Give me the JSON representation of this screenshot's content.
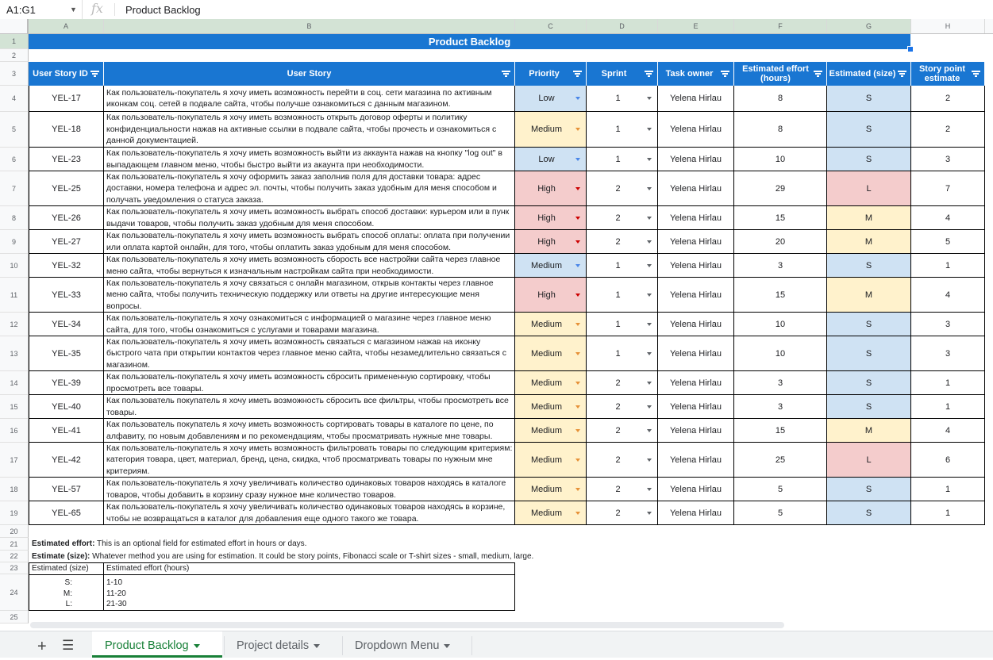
{
  "formula_bar": {
    "name_box": "A1:G1",
    "fx": "fx",
    "content": "Product Backlog"
  },
  "columns": [
    "A",
    "B",
    "C",
    "D",
    "E",
    "F",
    "G",
    "H"
  ],
  "rows": [
    "1",
    "2",
    "3",
    "4",
    "5",
    "6",
    "7",
    "8",
    "9",
    "10",
    "11",
    "12",
    "13",
    "14",
    "15",
    "16",
    "17",
    "18",
    "19",
    "20",
    "21",
    "22",
    "23",
    "24",
    "25"
  ],
  "title": "Product Backlog",
  "headers": {
    "id": "User Story ID",
    "story": "User Story",
    "priority": "Priority",
    "sprint": "Sprint",
    "owner": "Task owner",
    "effort": "Estimated effort (hours)",
    "size": "Estimated (size)",
    "points": "Story point estimate"
  },
  "stories": [
    {
      "id": "YEL-17",
      "story": "Как пользователь-покупатель я хочу иметь возможность перейти в соц. сети магазина по активным иконкам соц. сетей в подвале сайта, чтобы получше ознакомиться с данным магазином.",
      "priority": "Low",
      "sprint": "1",
      "owner": "Yelena Hirlau",
      "effort": "8",
      "size": "S",
      "points": "2"
    },
    {
      "id": "YEL-18",
      "story": "Как пользователь-покупатель я хочу иметь возможность открыть договор оферты и политику конфиденциальности нажав на активные ссылки в подвале сайта, чтобы прочесть и ознакомиться с данной документацией.",
      "priority": "Medium",
      "sprint": "1",
      "owner": "Yelena Hirlau",
      "effort": "8",
      "size": "S",
      "points": "2"
    },
    {
      "id": "YEL-23",
      "story": "Как пользователь-покупатель я хочу иметь возможность выйти из аккаунта нажав на кнопку \"log out\" в выпадающем главном меню, чтобы быстро выйти из акаунта при необходимости.",
      "priority": "Low",
      "sprint": "1",
      "owner": "Yelena Hirlau",
      "effort": "10",
      "size": "S",
      "points": "3"
    },
    {
      "id": "YEL-25",
      "story": "Как пользователь-покупатель я хочу оформить заказ заполнив поля для доставки товара: адрес доставки, номера телефона и адрес эл. почты, чтобы получить заказ удобным для меня способом и получать уведомления о статуса заказа.",
      "priority": "High",
      "sprint": "2",
      "owner": "Yelena Hirlau",
      "effort": "29",
      "size": "L",
      "points": "7"
    },
    {
      "id": "YEL-26",
      "story": "Как пользователь-покупатель я хочу иметь возможность выбрать способ доставки: курьером или в пунк выдачи товаров, чтобы получить заказ удобным для меня способом.",
      "priority": "High",
      "sprint": "2",
      "owner": "Yelena Hirlau",
      "effort": "15",
      "size": "M",
      "points": "4"
    },
    {
      "id": "YEL-27",
      "story": "Как пользователь-покупатель я хочу иметь возможность выбрать способ оплаты: оплата при получении или оплата картой онлайн, для того, чтобы оплатить заказ удобным для меня способом.",
      "priority": "High",
      "sprint": "2",
      "owner": "Yelena Hirlau",
      "effort": "20",
      "size": "M",
      "points": "5"
    },
    {
      "id": "YEL-32",
      "story": "Как пользователь-покупатель я хочу иметь возможность сборость все настройки сайта через главное меню сайта, чтобы вернуться к изначальным настройкам сайта при необходимости.",
      "priority": "Medium",
      "sprint": "1",
      "owner": "Yelena Hirlau",
      "effort": "3",
      "size": "S",
      "points": "1",
      "priorityStyle": "low"
    },
    {
      "id": "YEL-33",
      "story": "Как пользователь-покупатель я хочу связаться с онлайн магазином, открыв контакты через главное меню сайта, чтобы получить техническую поддержку или ответы на другие интересующие меня вопросы.",
      "priority": "High",
      "sprint": "1",
      "owner": "Yelena Hirlau",
      "effort": "15",
      "size": "M",
      "points": "4"
    },
    {
      "id": "YEL-34",
      "story": "Как пользователь-покупатель я хочу ознакомиться с информацией о магазине через главное меню сайта, для того, чтобы ознакомиться с услугами и товарами магазина.",
      "priority": "Medium",
      "sprint": "1",
      "owner": "Yelena Hirlau",
      "effort": "10",
      "size": "S",
      "points": "3"
    },
    {
      "id": "YEL-35",
      "story": "Как пользователь-покупатель я хочу иметь возможность связаться с магазином нажав на иконку быстрого чата при открытии контактов через главное меню сайта, чтобы незамедлительно связаться с магазином.",
      "priority": "Medium",
      "sprint": "1",
      "owner": "Yelena Hirlau",
      "effort": "10",
      "size": "S",
      "points": "3"
    },
    {
      "id": "YEL-39",
      "story": "Как пользователь-покупатель я хочу иметь возможность сбросить примененную сортировку, чтобы просмотреть все товары.",
      "priority": "Medium",
      "sprint": "2",
      "owner": "Yelena Hirlau",
      "effort": "3",
      "size": "S",
      "points": "1"
    },
    {
      "id": "YEL-40",
      "story": "Как пользователь покупатель я хочу иметь возможность сбросить все фильтры, чтобы просмотреть все товары.",
      "priority": "Medium",
      "sprint": "2",
      "owner": "Yelena Hirlau",
      "effort": "3",
      "size": "S",
      "points": "1"
    },
    {
      "id": "YEL-41",
      "story": "Как пользователь покупатель я хочу иметь возможность сортировать товары в каталоге по цене, по алфавиту, по новым добавлениям и по рекомендациям, чтобы просматривать нужные мне товары.",
      "priority": "Medium",
      "sprint": "2",
      "owner": "Yelena Hirlau",
      "effort": "15",
      "size": "M",
      "points": "4"
    },
    {
      "id": "YEL-42",
      "story": "Как пользователь-покупатель я хочу иметь возможность фильтровать товары по следующим критериям: категория товара, цвет, материал, бренд, цена, скидка, чтоб просматривать товары по нужным мне критериям.",
      "priority": "Medium",
      "sprint": "2",
      "owner": "Yelena Hirlau",
      "effort": "25",
      "size": "L",
      "points": "6"
    },
    {
      "id": "YEL-57",
      "story": "Как пользователь-покупатель я хочу увеличивать количество одинаковых товаров находясь в каталоге товаров, чтобы добавить в корзину сразу нужное мне количество товаров.",
      "priority": "Medium",
      "sprint": "2",
      "owner": "Yelena Hirlau",
      "effort": "5",
      "size": "S",
      "points": "1"
    },
    {
      "id": "YEL-65",
      "story": "Как пользователь-покупатель я хочу увеличивать количество одинаковых товаров находясь в корзине, чтобы не возвращаться в каталог для добавления еще одного такого же товара.",
      "priority": "Medium",
      "sprint": "2",
      "owner": "Yelena Hirlau",
      "effort": "5",
      "size": "S",
      "points": "1"
    }
  ],
  "notes": {
    "effort_label": "Estimated effort:",
    "effort_text": " This is an optional field for estimated effort in hours or days.",
    "size_label": "Estimate (size):",
    "size_text": " Whatever method you are using for estimation. It could be story points, Fibonacci scale or T-shirt sizes - small, medium, large."
  },
  "legend": {
    "h1": "Estimated (size)",
    "h2": "Estimated effort (hours)",
    "sizes": [
      "S:",
      "M:",
      "L:"
    ],
    "ranges": [
      "1-10",
      "11-20",
      "21-30"
    ]
  },
  "tabs": [
    "Product Backlog",
    "Project details",
    "Dropdown Menu"
  ],
  "colors": {
    "header_blue": "#1976d2",
    "low": "#cfe2f3",
    "medium": "#fff2cc",
    "high": "#f4cccc"
  }
}
